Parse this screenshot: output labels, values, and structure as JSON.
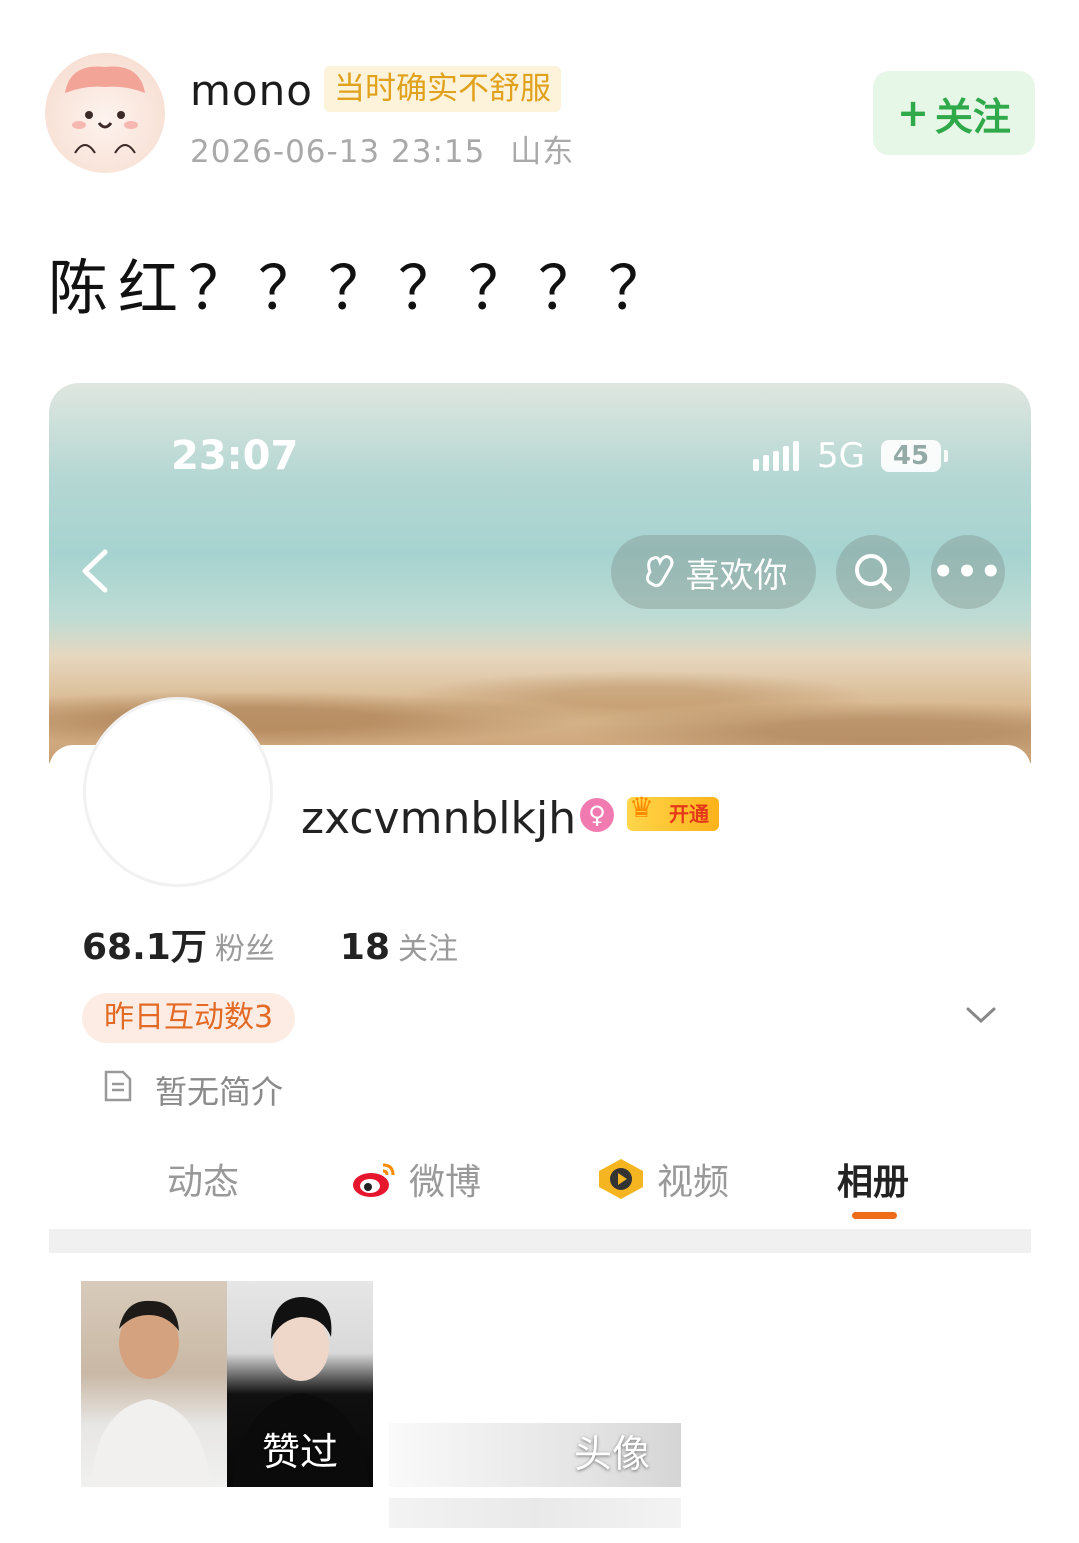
{
  "post": {
    "author_name": "mono",
    "author_tag": "当时确实不舒服",
    "timestamp": "2026-06-13 23:15",
    "location": "山东",
    "follow_label": "关注",
    "text": "陈红？？？？？？？"
  },
  "embedded": {
    "status_bar": {
      "time": "23:07",
      "network": "5G",
      "battery": "45"
    },
    "like_button_label": "喜欢你",
    "profile": {
      "username": "zxcvmnblkjh",
      "female_badge_symbol": "♀",
      "vip_badge_label": "开通",
      "followers_count": "68.1万",
      "followers_label": "粉丝",
      "following_count": "18",
      "following_label": "关注",
      "interaction_badge": "昨日互动数3",
      "bio": "暂无简介"
    },
    "tabs": [
      {
        "label": "动态",
        "active": false
      },
      {
        "label": "微博",
        "active": false
      },
      {
        "label": "视频",
        "active": false
      },
      {
        "label": "相册",
        "active": true
      }
    ],
    "album": {
      "liked_label": "赞过",
      "avatar_label": "头像"
    }
  },
  "colors": {
    "follow_green": "#2fa94a",
    "accent_orange": "#ef6c1b",
    "tag_gold": "#e0a21c"
  }
}
